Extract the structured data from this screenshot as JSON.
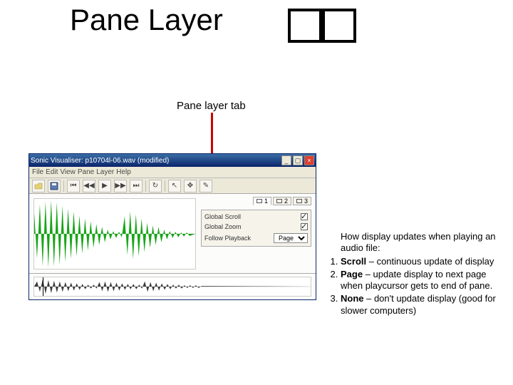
{
  "slide": {
    "title": "Pane Layer",
    "annotation": "Pane layer tab",
    "boxglyph": "□□"
  },
  "window": {
    "title": "Sonic Visualiser: p10704l-06.wav (modified)",
    "menu": [
      "File",
      "Edit",
      "View",
      "Pane",
      "Layer",
      "Help"
    ],
    "tabs": [
      {
        "label": "1",
        "selected": true
      },
      {
        "label": "2",
        "selected": false
      },
      {
        "label": "3",
        "selected": false
      }
    ],
    "props": {
      "global_scroll": {
        "label": "Global Scroll",
        "checked": true
      },
      "global_zoom": {
        "label": "Global Zoom",
        "checked": true
      },
      "follow_playback": {
        "label": "Follow Playback",
        "value": "Page"
      }
    }
  },
  "description": {
    "lead": "How display updates when playing an audio file:",
    "items": [
      {
        "term": "Scroll",
        "rest": " – continuous update of display"
      },
      {
        "term": "Page",
        "rest": " – update display to next page when playcursor gets to end of pane."
      },
      {
        "term": "None",
        "rest": " – don't update display (good for slower computers)"
      }
    ]
  }
}
